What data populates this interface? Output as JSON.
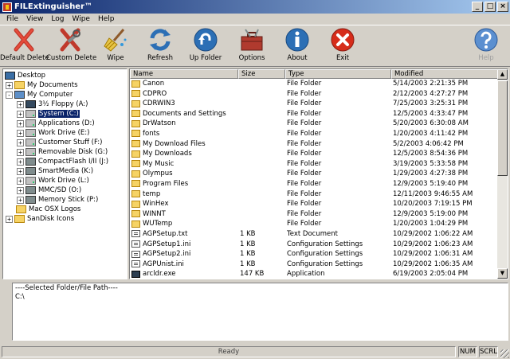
{
  "window": {
    "title": "FILExtinguisher™",
    "controls": {
      "minimize": "_",
      "maximize": "□",
      "close": "×"
    }
  },
  "menu": [
    "File",
    "View",
    "Log",
    "Wipe",
    "Help"
  ],
  "toolbar": [
    {
      "id": "default-delete",
      "label": "Default Delete",
      "icon": "red-x-icon"
    },
    {
      "id": "custom-delete",
      "label": "Custom Delete",
      "icon": "red-x-tools-icon"
    },
    {
      "id": "wipe",
      "label": "Wipe",
      "icon": "broom-icon"
    },
    {
      "id": "refresh",
      "label": "Refresh",
      "icon": "refresh-arrows-icon"
    },
    {
      "id": "up-folder",
      "label": "Up Folder",
      "icon": "up-arrow-icon"
    },
    {
      "id": "options",
      "label": "Options",
      "icon": "toolbox-icon"
    },
    {
      "id": "about",
      "label": "About",
      "icon": "info-icon"
    },
    {
      "id": "exit",
      "label": "Exit",
      "icon": "exit-icon"
    },
    {
      "id": "help",
      "label": "Help",
      "icon": "help-icon",
      "disabled": true
    }
  ],
  "tree": [
    {
      "label": "Desktop",
      "icon": "desktop"
    },
    {
      "label": "My Documents",
      "icon": "folder",
      "expander": "+"
    },
    {
      "label": "My Computer",
      "icon": "computer",
      "expander": "-"
    },
    {
      "label": "3½ Floppy (A:)",
      "icon": "floppy",
      "expander": "+"
    },
    {
      "label": "System (C:)",
      "icon": "drive",
      "expander": "+",
      "selected": true
    },
    {
      "label": "Applications (D:)",
      "icon": "drive",
      "expander": "+"
    },
    {
      "label": "Work Drive (E:)",
      "icon": "drive",
      "expander": "+"
    },
    {
      "label": "Customer Stuff (F:)",
      "icon": "drive",
      "expander": "+"
    },
    {
      "label": "Removable Disk (G:)",
      "icon": "drive",
      "expander": "+"
    },
    {
      "label": "CompactFlash I/II (J:)",
      "icon": "card",
      "expander": "+"
    },
    {
      "label": "SmartMedia (K:)",
      "icon": "card",
      "expander": "+"
    },
    {
      "label": "Work Drive (L:)",
      "icon": "drive",
      "expander": "+"
    },
    {
      "label": "MMC/SD (O:)",
      "icon": "card",
      "expander": "+"
    },
    {
      "label": "Memory Stick (P:)",
      "icon": "card",
      "expander": "+"
    },
    {
      "label": "Mac OSX Logos",
      "icon": "folder"
    },
    {
      "label": "SanDisk Icons",
      "icon": "folder",
      "expander": "+"
    }
  ],
  "list": {
    "columns": {
      "name": "Name",
      "size": "Size",
      "type": "Type",
      "modified": "Modified"
    },
    "rows": [
      {
        "name": "Canon",
        "size": "",
        "type": "File Folder",
        "modified": "5/14/2003 2:21:35 PM",
        "icon": "folder"
      },
      {
        "name": "CDPRO",
        "size": "",
        "type": "File Folder",
        "modified": "2/12/2003 4:27:27 PM",
        "icon": "folder"
      },
      {
        "name": "CDRWIN3",
        "size": "",
        "type": "File Folder",
        "modified": "7/25/2003 3:25:31 PM",
        "icon": "folder"
      },
      {
        "name": "Documents and Settings",
        "size": "",
        "type": "File Folder",
        "modified": "12/5/2003 4:33:47 PM",
        "icon": "folder"
      },
      {
        "name": "DrWatson",
        "size": "",
        "type": "File Folder",
        "modified": "5/20/2003 6:30:08 AM",
        "icon": "folder"
      },
      {
        "name": "fonts",
        "size": "",
        "type": "File Folder",
        "modified": "1/20/2003 4:11:42 PM",
        "icon": "folder"
      },
      {
        "name": "My Download Files",
        "size": "",
        "type": "File Folder",
        "modified": "5/2/2003 4:06:42 PM",
        "icon": "folder"
      },
      {
        "name": "My Downloads",
        "size": "",
        "type": "File Folder",
        "modified": "12/5/2003 8:54:36 PM",
        "icon": "folder"
      },
      {
        "name": "My Music",
        "size": "",
        "type": "File Folder",
        "modified": "3/19/2003 5:33:58 PM",
        "icon": "folder"
      },
      {
        "name": "Olympus",
        "size": "",
        "type": "File Folder",
        "modified": "1/29/2003 4:27:38 PM",
        "icon": "folder"
      },
      {
        "name": "Program Files",
        "size": "",
        "type": "File Folder",
        "modified": "12/9/2003 5:19:40 PM",
        "icon": "folder"
      },
      {
        "name": "temp",
        "size": "",
        "type": "File Folder",
        "modified": "12/11/2003 9:46:55 AM",
        "icon": "folder"
      },
      {
        "name": "WinHex",
        "size": "",
        "type": "File Folder",
        "modified": "10/20/2003 7:19:15 PM",
        "icon": "folder"
      },
      {
        "name": "WINNT",
        "size": "",
        "type": "File Folder",
        "modified": "12/9/2003 5:19:00 PM",
        "icon": "folder"
      },
      {
        "name": "WUTemp",
        "size": "",
        "type": "File Folder",
        "modified": "1/20/2003 1:04:29 PM",
        "icon": "folder"
      },
      {
        "name": "AGPSetup.txt",
        "size": "1 KB",
        "type": "Text Document",
        "modified": "10/29/2002 1:06:22 AM",
        "icon": "file"
      },
      {
        "name": "AGPSetup1.ini",
        "size": "1 KB",
        "type": "Configuration Settings",
        "modified": "10/29/2002 1:06:23 AM",
        "icon": "file"
      },
      {
        "name": "AGPSetup2.ini",
        "size": "1 KB",
        "type": "Configuration Settings",
        "modified": "10/29/2002 1:06:31 AM",
        "icon": "file"
      },
      {
        "name": "AGPUnist.ini",
        "size": "1 KB",
        "type": "Configuration Settings",
        "modified": "10/29/2002 1:06:35 AM",
        "icon": "file"
      },
      {
        "name": "arcldr.exe",
        "size": "147 KB",
        "type": "Application",
        "modified": "6/19/2003 2:05:04 PM",
        "icon": "exe"
      }
    ]
  },
  "path_panel": {
    "header": "----Selected Folder/File Path----",
    "value": "C:\\"
  },
  "status": {
    "message": "Ready",
    "indicators": [
      "NUM",
      "SCRL"
    ]
  }
}
